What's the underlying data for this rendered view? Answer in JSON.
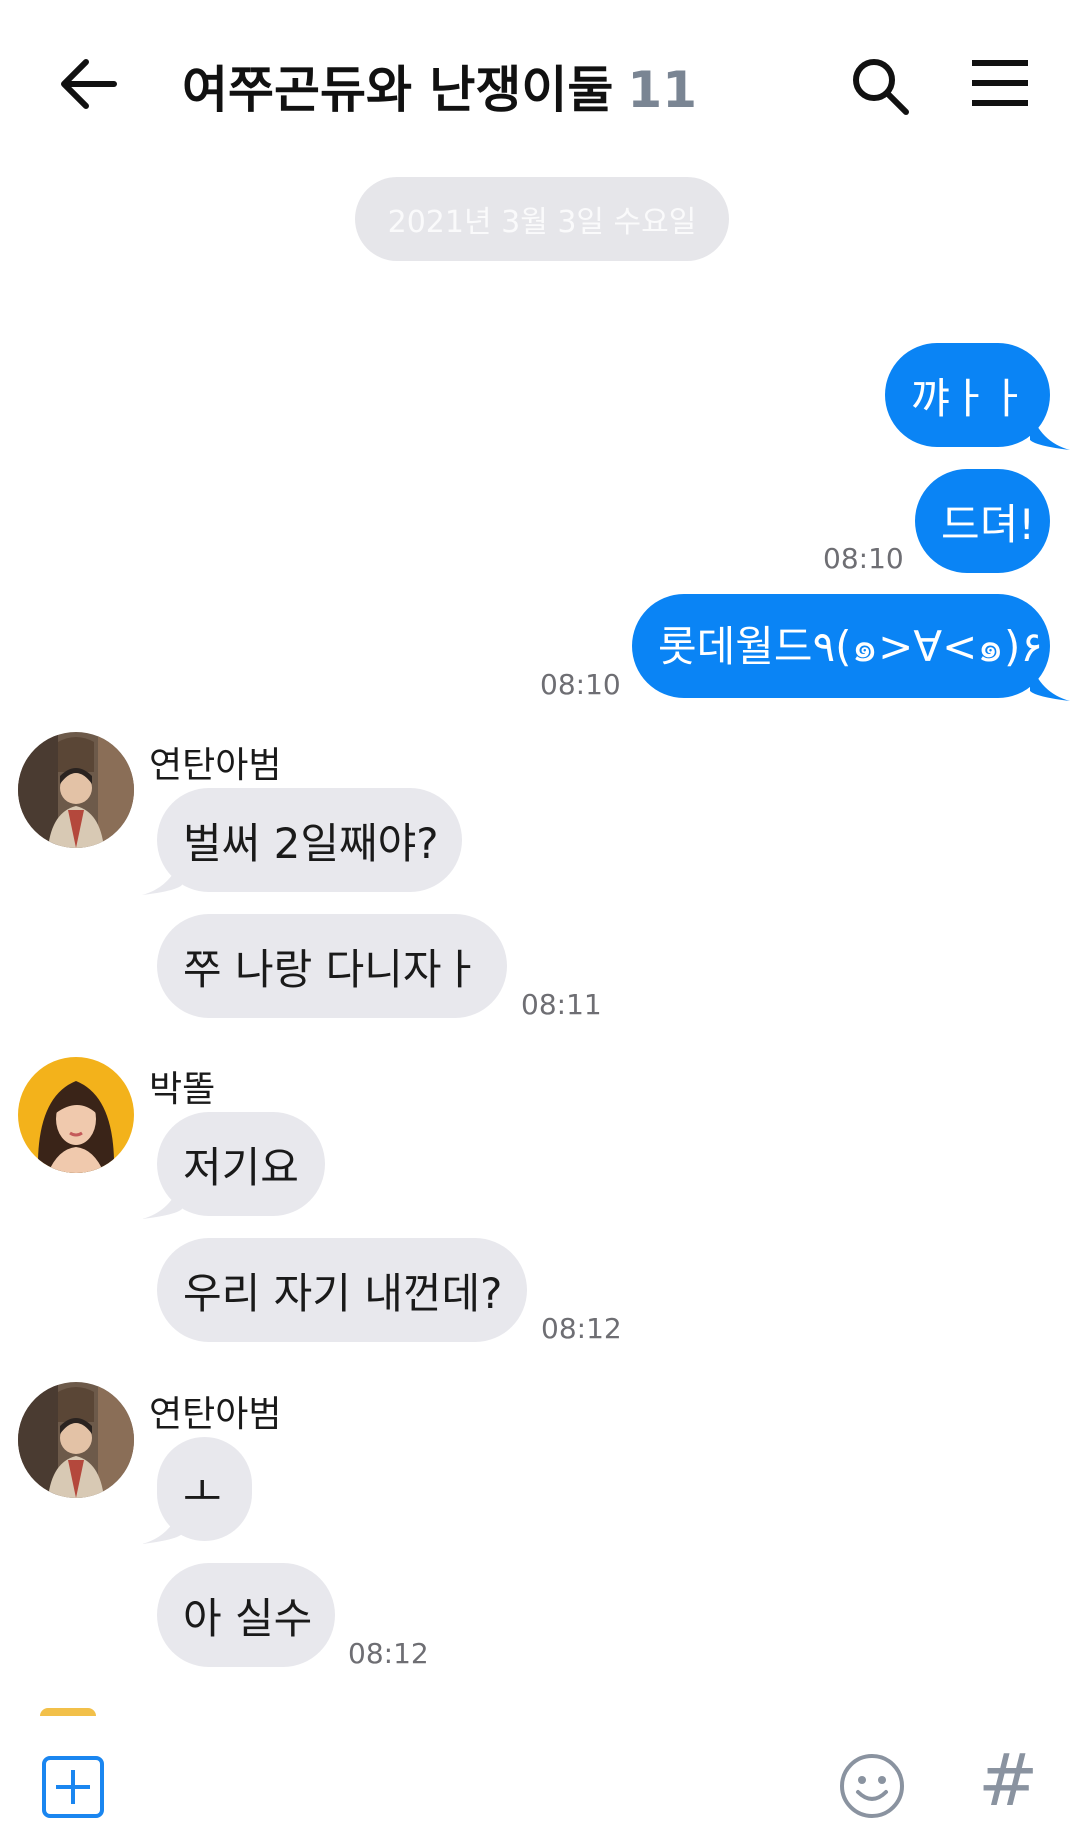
{
  "header": {
    "title": "여쭈곤듀와 난쟁이둘",
    "member_count": "11",
    "back_icon": "arrow-left-icon",
    "search_icon": "search-icon",
    "menu_icon": "hamburger-menu-icon"
  },
  "date_divider": "2021년 3월 3일 수요일",
  "messages": {
    "out1": {
      "text": "꺄ㅏㅏ"
    },
    "out2": {
      "text": "드뎌!",
      "time": "08:10"
    },
    "out3": {
      "text": "롯데월드٩(๑>∀<๑)۶",
      "time": "08:10"
    },
    "group1": {
      "sender": "연탄아범",
      "m1": "벌써 2일째야?",
      "m2": "쭈 나랑 다니자ㅏ",
      "time": "08:11"
    },
    "group2": {
      "sender": "박똘",
      "m1": "저기요",
      "m2": "우리 자기 내껀데?",
      "time": "08:12"
    },
    "group3": {
      "sender": "연탄아범",
      "m1": "ㅗ",
      "m2": "아 실수",
      "time": "08:12"
    }
  },
  "bottom_bar": {
    "add_icon": "plus-square-icon",
    "emoji_icon": "smiley-icon",
    "hashtag": "#"
  },
  "colors": {
    "outgoing_bubble": "#0a84f5",
    "incoming_bubble": "#e8e8ed",
    "accent": "#1a86f0"
  }
}
